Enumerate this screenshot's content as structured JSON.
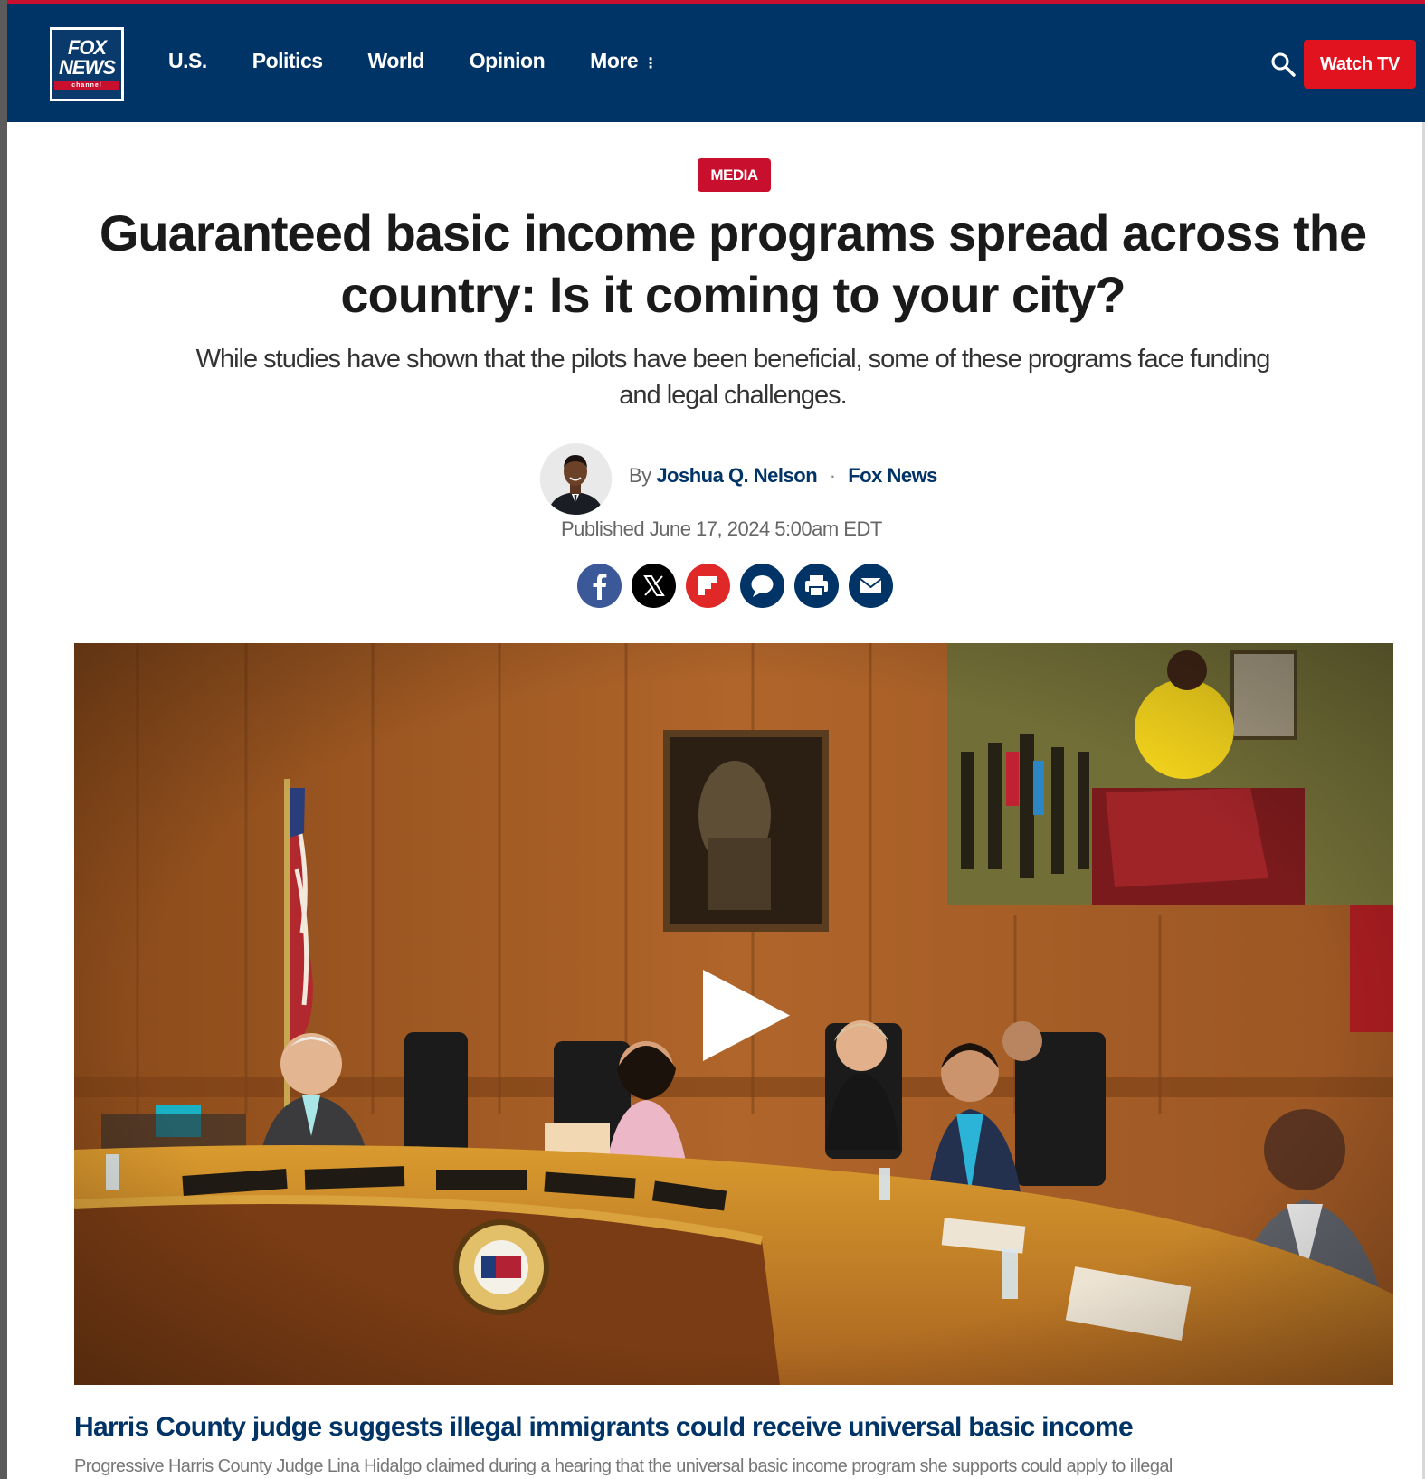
{
  "header": {
    "logo": {
      "line1": "FOX",
      "line2": "NEWS",
      "line3": "channel"
    },
    "nav": [
      {
        "label": "U.S."
      },
      {
        "label": "Politics"
      },
      {
        "label": "World"
      },
      {
        "label": "Opinion"
      },
      {
        "label": "More"
      }
    ],
    "watch_tv_label": "Watch TV",
    "colors": {
      "bar": "#003366",
      "accent": "#c8102e",
      "watch_button": "#e0131f"
    }
  },
  "article": {
    "category": "MEDIA",
    "headline_line1": "Guaranteed basic income programs spread across the",
    "headline_line2": "country: Is it coming to your city?",
    "subhead_line1": "While studies have shown that the pilots have been beneficial, some of these programs face funding",
    "subhead_line2": "and legal challenges.",
    "byline": {
      "by": "By",
      "author": "Joshua Q. Nelson",
      "source": "Fox News"
    },
    "published": "Published June 17, 2024 5:00am EDT",
    "share_icons": [
      "facebook-icon",
      "x-icon",
      "flipboard-icon",
      "comment-icon",
      "print-icon",
      "email-icon"
    ]
  },
  "video": {
    "caption_title": "Harris County judge suggests illegal immigrants could receive universal basic income",
    "caption_text": "Progressive Harris County Judge Lina Hidalgo claimed during a hearing that the universal basic income program she supports could apply to illegal"
  }
}
